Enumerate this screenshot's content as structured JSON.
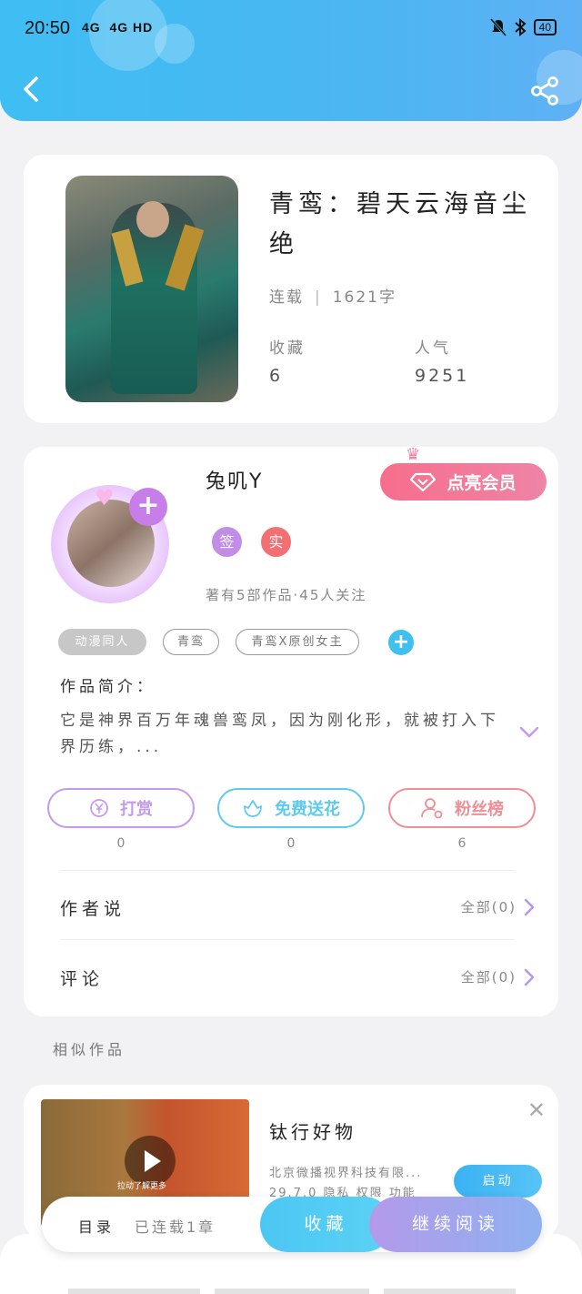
{
  "status_bar": {
    "time": "20:50",
    "network": "4G  4G HD",
    "battery": "40"
  },
  "book": {
    "title": "青鸾：碧天云海音尘绝",
    "status": "连载",
    "word_count": "1621字",
    "favorites_label": "收藏",
    "favorites_value": "6",
    "popularity_label": "人气",
    "popularity_value": "9251"
  },
  "author": {
    "name": "兔叽Y",
    "vip_label": "点亮会员",
    "badge_sign": "签",
    "badge_real": "实",
    "meta": "著有5部作品·45人关注",
    "tags": [
      "动漫同人",
      "青鸾",
      "青鸾X原创女主"
    ]
  },
  "intro": {
    "label": "作品简介：",
    "text": "它是神界百万年魂兽鸾凤，因为刚化形，就被打入下界历练，..."
  },
  "actions": [
    {
      "label": "打赏",
      "count": "0",
      "color": "#c59ae8"
    },
    {
      "label": "免费送花",
      "count": "0",
      "color": "#5ccbee"
    },
    {
      "label": "粉丝榜",
      "count": "6",
      "color": "#ee8f95"
    }
  ],
  "rows": {
    "author_says": {
      "label": "作者说",
      "right": "全部(0)"
    },
    "comments": {
      "label": "评论",
      "right": "全部(0)"
    }
  },
  "similar": {
    "label": "相似作品"
  },
  "ad": {
    "title": "钛行好物",
    "company": "北京微播视界科技有限...",
    "details": "29.7.0  隐私  权限  功能",
    "start": "启动",
    "caption": "拉动了解更多"
  },
  "bottom_bar": {
    "toc": "目录",
    "progress": "已连载1章",
    "favorite": "收藏",
    "continue": "继续阅读"
  },
  "icons": [
    "back-arrow-icon",
    "share-icon",
    "diamond-icon",
    "coin-icon",
    "flower-icon",
    "person-icon",
    "chevron-right-icon",
    "chevron-down-icon",
    "close-icon",
    "play-icon"
  ]
}
